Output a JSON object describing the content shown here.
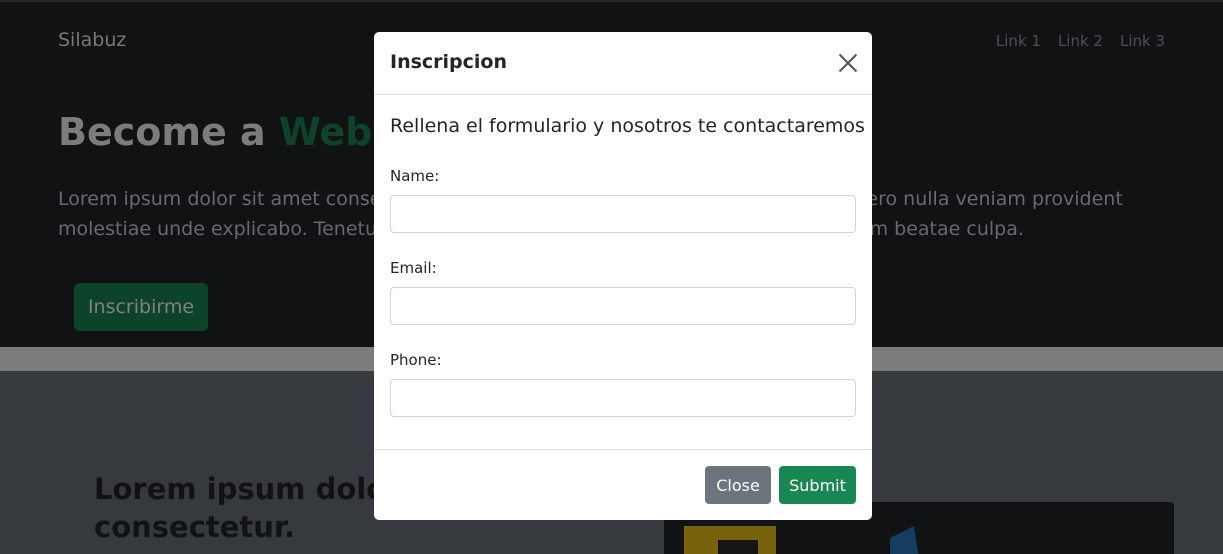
{
  "navbar": {
    "brand": "Silabuz",
    "links": [
      "Link 1",
      "Link 2",
      "Link 3"
    ]
  },
  "hero": {
    "title_prefix": "Become a ",
    "title_accent": "Web De",
    "text_line1_left": "Lorem ipsum dolor sit amet consect",
    "text_line1_right": "pero nulla veniam provident",
    "text_line2_left": "molestiae unde explicabo. Tenetur p",
    "text_line2_right": "em beatae culpa.",
    "button_label": "Inscribirme"
  },
  "section": {
    "title_line1": "Lorem ipsum dolor",
    "title_line2": "consectetur."
  },
  "modal": {
    "title": "Inscripcion",
    "lead": "Rellena el formulario y nosotros te contactaremos",
    "fields": [
      {
        "label": "Name:",
        "value": ""
      },
      {
        "label": "Email:",
        "value": ""
      },
      {
        "label": "Phone:",
        "value": ""
      }
    ],
    "close_label": "Close",
    "submit_label": "Submit"
  },
  "colors": {
    "accent": "#198754",
    "secondary": "#6c757d",
    "dark": "#212529"
  },
  "icons": [
    "close-icon"
  ]
}
